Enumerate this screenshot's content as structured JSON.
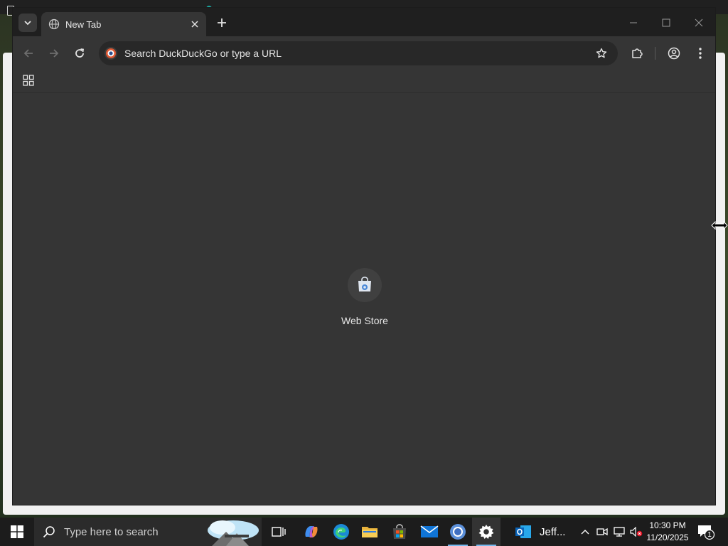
{
  "browser": {
    "tab": {
      "title": "New Tab"
    },
    "omnibox": {
      "placeholder": "Search DuckDuckGo or type a URL"
    },
    "shortcuts": [
      {
        "label": "Web Store"
      }
    ]
  },
  "taskbar": {
    "search_placeholder": "Type here to search",
    "outlook_label": "Jeff...",
    "clock_time": "10:30 PM",
    "clock_date": "11/20/2025",
    "notification_count": "1"
  },
  "colors": {
    "accent_running": "#76b9ed",
    "window_bg": "#353535",
    "tabstrip_bg": "#1f1f1f"
  }
}
